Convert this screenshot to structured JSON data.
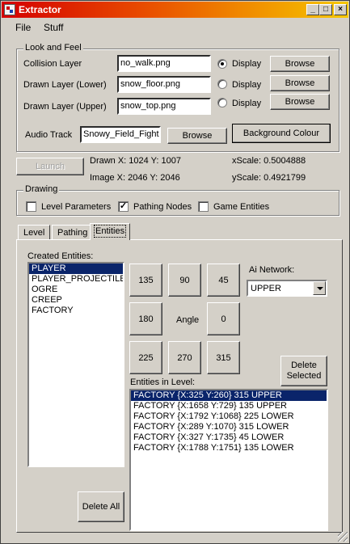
{
  "window": {
    "title": "Extractor"
  },
  "menu": {
    "file": "File",
    "stuff": "Stuff"
  },
  "look_and_feel": {
    "legend": "Look and Feel",
    "rows": [
      {
        "label": "Collision Layer",
        "value": "no_walk.png",
        "radio_label": "Display",
        "selected": true,
        "browse": "Browse"
      },
      {
        "label": "Drawn Layer (Lower)",
        "value": "snow_floor.png",
        "radio_label": "Display",
        "selected": false,
        "browse": "Browse"
      },
      {
        "label": "Drawn Layer (Upper)",
        "value": "snow_top.png",
        "radio_label": "Display",
        "selected": false,
        "browse": "Browse"
      }
    ],
    "audio_label": "Audio Track",
    "audio_value": "Snowy_Field_Fight",
    "audio_browse": "Browse",
    "background_colour": "Background Colour"
  },
  "status": {
    "launch": "Launch",
    "drawn": "Drawn X: 1024  Y: 1007",
    "image": "Image X: 2046  Y: 2046",
    "xscale": "xScale: 0.5004888",
    "yscale": "yScale: 0.4921799"
  },
  "drawing": {
    "legend": "Drawing",
    "options": [
      {
        "label": "Level Parameters",
        "checked": false
      },
      {
        "label": "Pathing Nodes",
        "checked": true
      },
      {
        "label": "Game Entities",
        "checked": false
      }
    ]
  },
  "tabs": [
    "Level",
    "Pathing",
    "Entities"
  ],
  "entities": {
    "created_label": "Created Entities:",
    "created": [
      "PLAYER",
      "PLAYER_PROJECTILE",
      "OGRE",
      "CREEP",
      "FACTORY"
    ],
    "angles": {
      "a135": "135",
      "a90": "90",
      "a45": "45",
      "a180": "180",
      "angle_label": "Angle",
      "a0": "0",
      "a225": "225",
      "a270": "270",
      "a315": "315"
    },
    "ai_label": "Ai Network:",
    "ai_value": "UPPER",
    "delete_selected": "Delete Selected",
    "in_level_label": "Entities in Level:",
    "in_level": [
      "FACTORY  {X:325 Y:260}  315  UPPER",
      "FACTORY  {X:1658 Y:729}  135  UPPER",
      "FACTORY  {X:1792 Y:1068}  225  LOWER",
      "FACTORY  {X:289 Y:1070}  315  LOWER",
      "FACTORY  {X:327 Y:1735}  45  LOWER",
      "FACTORY  {X:1788 Y:1751}  135  LOWER"
    ],
    "delete_all": "Delete All"
  }
}
